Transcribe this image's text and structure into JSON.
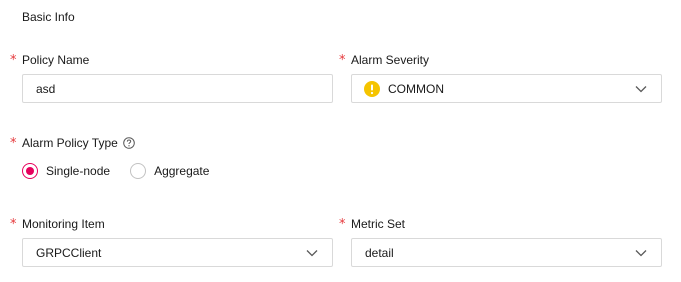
{
  "section": {
    "title": "Basic Info"
  },
  "fields": {
    "policy_name": {
      "label": "Policy Name",
      "value": "asd",
      "required_mark": "*"
    },
    "alarm_severity": {
      "label": "Alarm Severity",
      "value": "COMMON",
      "icon": "warning-circle-icon",
      "icon_color": "#f5c400",
      "required_mark": "*"
    },
    "alarm_policy_type": {
      "label": "Alarm Policy Type",
      "required_mark": "*",
      "help_icon": "help-circle-icon",
      "options": [
        {
          "label": "Single-node",
          "checked": true
        },
        {
          "label": "Aggregate",
          "checked": false
        }
      ]
    },
    "monitoring_item": {
      "label": "Monitoring Item",
      "value": "GRPCClient",
      "required_mark": "*"
    },
    "metric_set": {
      "label": "Metric Set",
      "value": "detail",
      "required_mark": "*"
    }
  },
  "colors": {
    "required": "#e5383b",
    "accent": "#e6005c",
    "border": "#d9d9d9"
  }
}
